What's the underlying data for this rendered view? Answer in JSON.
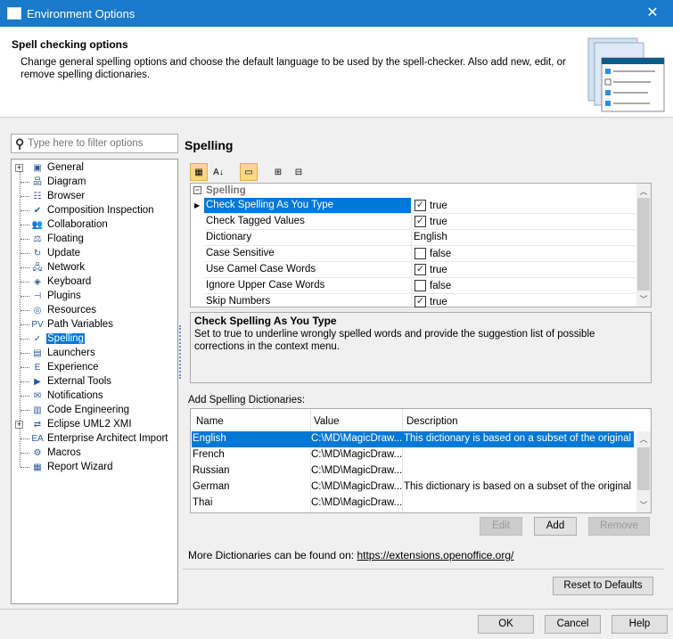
{
  "window": {
    "title": "Environment Options",
    "close": "✕"
  },
  "header": {
    "title": "Spell checking options",
    "description": "Change general spelling options and choose the default language to be used by the spell-checker. Also add new, edit, or remove spelling dictionaries."
  },
  "filter": {
    "placeholder": "Type here to filter options"
  },
  "tree": [
    {
      "label": "General",
      "icon": "general-icon",
      "expandable": true
    },
    {
      "label": "Diagram",
      "icon": "diagram-icon"
    },
    {
      "label": "Browser",
      "icon": "browser-icon"
    },
    {
      "label": "Composition Inspection",
      "icon": "composition-icon"
    },
    {
      "label": "Collaboration",
      "icon": "collaboration-icon"
    },
    {
      "label": "Floating",
      "icon": "floating-icon"
    },
    {
      "label": "Update",
      "icon": "update-icon"
    },
    {
      "label": "Network",
      "icon": "network-icon"
    },
    {
      "label": "Keyboard",
      "icon": "keyboard-icon"
    },
    {
      "label": "Plugins",
      "icon": "plugins-icon"
    },
    {
      "label": "Resources",
      "icon": "resources-icon"
    },
    {
      "label": "Path Variables",
      "icon": "path-variables-icon"
    },
    {
      "label": "Spelling",
      "icon": "spelling-icon",
      "selected": true
    },
    {
      "label": "Launchers",
      "icon": "launchers-icon"
    },
    {
      "label": "Experience",
      "icon": "experience-icon"
    },
    {
      "label": "External Tools",
      "icon": "external-tools-icon"
    },
    {
      "label": "Notifications",
      "icon": "notifications-icon"
    },
    {
      "label": "Code Engineering",
      "icon": "code-engineering-icon"
    },
    {
      "label": "Eclipse UML2 XMI",
      "icon": "eclipse-icon",
      "expandable": true
    },
    {
      "label": "Enterprise Architect Import",
      "icon": "ea-icon"
    },
    {
      "label": "Macros",
      "icon": "macros-icon"
    },
    {
      "label": "Report Wizard",
      "icon": "report-wizard-icon"
    }
  ],
  "panel": {
    "title": "Spelling",
    "group": "Spelling",
    "properties": [
      {
        "name": "Check Spelling As You Type",
        "value": "true",
        "checkbox": true,
        "checked": true,
        "selected": true
      },
      {
        "name": "Check Tagged Values",
        "value": "true",
        "checkbox": true,
        "checked": true
      },
      {
        "name": "Dictionary",
        "value": "English",
        "checkbox": false
      },
      {
        "name": "Case Sensitive",
        "value": "false",
        "checkbox": true,
        "checked": false
      },
      {
        "name": "Use Camel Case Words",
        "value": "true",
        "checkbox": true,
        "checked": true
      },
      {
        "name": "Ignore Upper Case Words",
        "value": "false",
        "checkbox": true,
        "checked": false
      },
      {
        "name": "Skip Numbers",
        "value": "true",
        "checkbox": true,
        "checked": true
      }
    ],
    "description_title": "Check Spelling As You Type",
    "description": "Set to true to underline wrongly spelled words and provide the suggestion list of possible corrections in the context menu."
  },
  "dictionaries": {
    "label": "Add Spelling Dictionaries:",
    "columns": [
      "Name",
      "Value",
      "Description"
    ],
    "rows": [
      {
        "name": "English",
        "value": "C:\\MD\\MagicDraw...",
        "description": "This dictionary is based on a subset of the original ..."
      },
      {
        "name": "French",
        "value": "C:\\MD\\MagicDraw...",
        "description": ""
      },
      {
        "name": "Russian",
        "value": "C:\\MD\\MagicDraw...",
        "description": ""
      },
      {
        "name": "German",
        "value": "C:\\MD\\MagicDraw...",
        "description": "This dictionary is based on a subset of the original ..."
      },
      {
        "name": "Thai",
        "value": "C:\\MD\\MagicDraw...",
        "description": ""
      }
    ],
    "edit": "Edit",
    "add": "Add",
    "remove": "Remove",
    "more_text": "More Dictionaries can be found on:",
    "more_link": "https://extensions.openoffice.org/"
  },
  "reset": "Reset to Defaults",
  "footer": {
    "ok": "OK",
    "cancel": "Cancel",
    "help": "Help"
  },
  "colors": {
    "accent": "#0078d7",
    "titlebar": "#1979ca"
  }
}
